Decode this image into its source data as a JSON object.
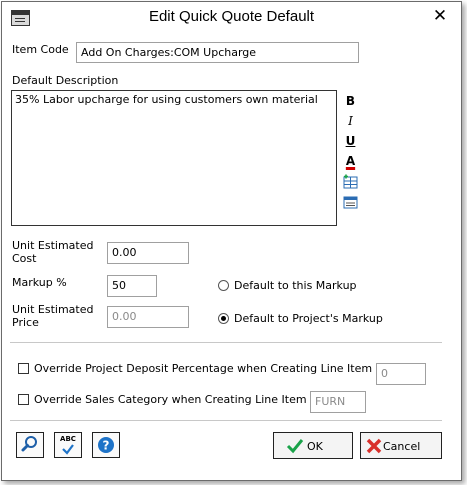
{
  "window": {
    "title": "Edit Quick Quote Default"
  },
  "item_code": {
    "label": "Item Code",
    "value": "Add On Charges:COM Upcharge"
  },
  "description": {
    "label": "Default Description",
    "value": "35%  Labor upcharge for using customers own material"
  },
  "format_toolbar": {
    "bold": "B",
    "italic": "I",
    "underline": "U",
    "font_color": "A"
  },
  "unit_cost": {
    "label": "Unit Estimated Cost",
    "value": "0.00"
  },
  "markup": {
    "label": "Markup %",
    "value": "50"
  },
  "unit_price": {
    "label": "Unit Estimated Price",
    "value": "0.00"
  },
  "markup_options": [
    {
      "label": "Default to this Markup",
      "selected": false
    },
    {
      "label": "Default to Project's Markup",
      "selected": true
    }
  ],
  "override_deposit": {
    "label": "Override Project Deposit Percentage when Creating Line Item",
    "checked": false,
    "value": "0"
  },
  "override_sales": {
    "label": "Override Sales Category when Creating Line Item",
    "checked": false,
    "value": "FURN"
  },
  "spell_check": {
    "label": "ABC"
  },
  "buttons": {
    "ok": "OK",
    "cancel": "Cancel"
  },
  "colors": {
    "ok_check": "#1aa34a",
    "cancel_x": "#d9302b",
    "help_blue": "#1e73c8",
    "font_color_bar": "#d00000"
  }
}
